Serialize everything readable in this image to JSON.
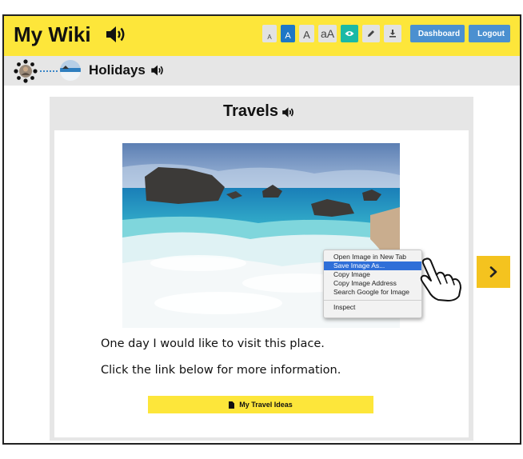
{
  "header": {
    "app_title": "My Wiki",
    "accent_color": "#fde63a",
    "toolbar": {
      "font_sizes": [
        "A",
        "A",
        "A",
        "aA"
      ],
      "selected_font_size_index": 1,
      "icons": [
        "eye-icon",
        "pencil-icon",
        "download-icon"
      ],
      "dashboard_label": "Dashboard",
      "logout_label": "Logout"
    }
  },
  "breadcrumb": {
    "current_label": "Holidays"
  },
  "card": {
    "title": "Travels",
    "context_menu": {
      "items": [
        "Open Image in New Tab",
        "Save Image As...",
        "Copy Image",
        "Copy Image Address",
        "Search Google for Image",
        "Inspect"
      ],
      "highlighted_index": 1
    },
    "paragraphs": [
      "One day I would like to visit this place.",
      "Click the link below for more information."
    ],
    "link_label": "My Travel Ideas"
  },
  "next_button_color": "#f4c31f"
}
